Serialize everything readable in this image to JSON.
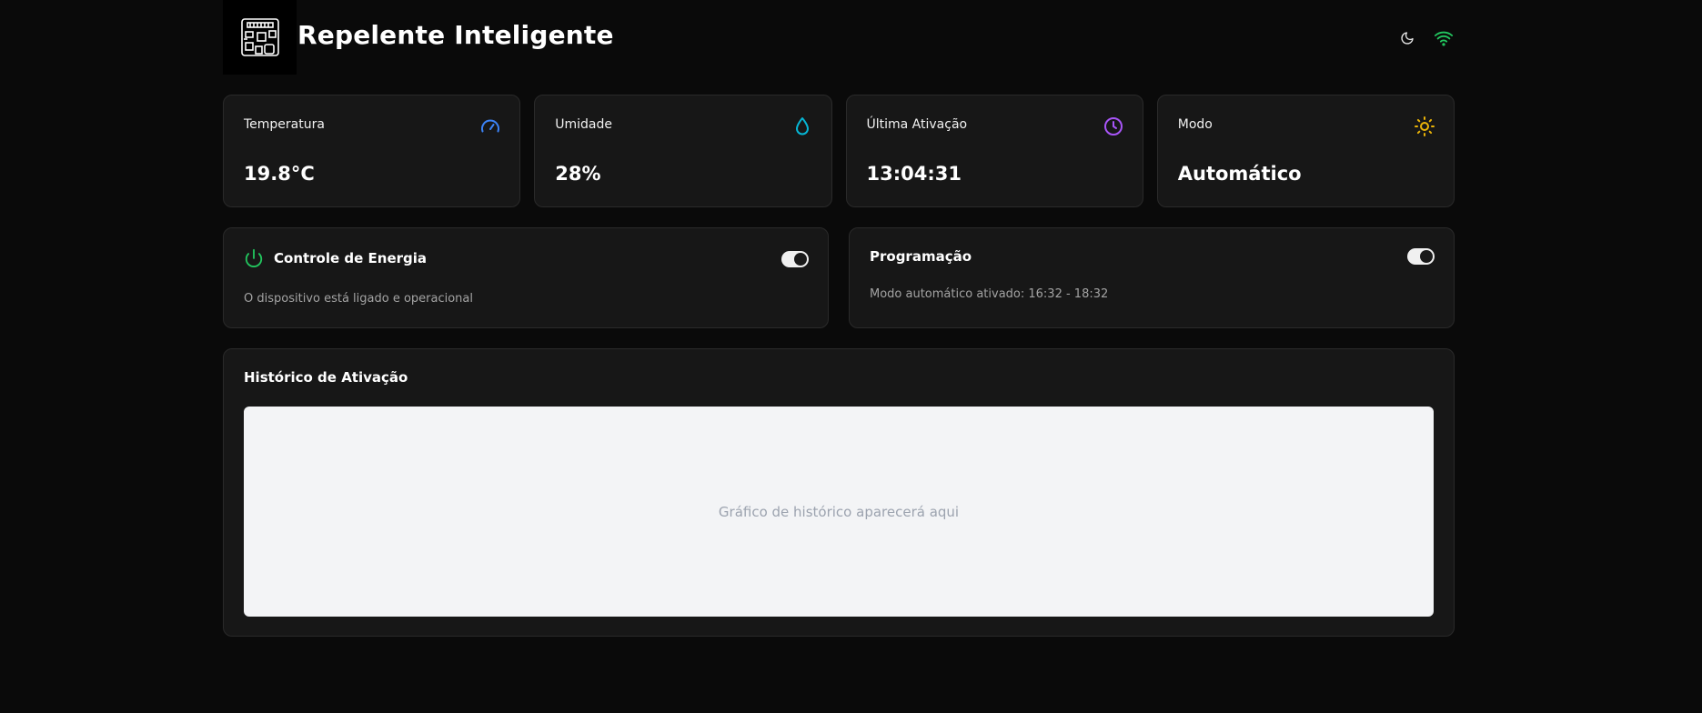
{
  "header": {
    "title": "Repelente Inteligente",
    "icons": [
      "circuit-board-icon",
      "moon-icon",
      "wifi-icon"
    ]
  },
  "stats": [
    {
      "label": "Temperatura",
      "value": "19.8°C",
      "icon": "gauge-icon",
      "color": "#3b82f6"
    },
    {
      "label": "Umidade",
      "value": "28%",
      "icon": "droplet-icon",
      "color": "#06b6d4"
    },
    {
      "label": "Última Ativação",
      "value": "13:04:31",
      "icon": "clock-icon",
      "color": "#a855f7"
    },
    {
      "label": "Modo",
      "value": "Automático",
      "icon": "sun-icon",
      "color": "#eab308"
    }
  ],
  "energy": {
    "title": "Controle de Energia",
    "description": "O dispositivo está ligado e operacional",
    "enabled": true,
    "icon": "power-icon",
    "color": "#22c55e"
  },
  "schedule": {
    "title": "Programação",
    "description": "Modo automático ativado: 16:32 - 18:32",
    "enabled": true
  },
  "history": {
    "title": "Histórico de Ativação",
    "placeholder": "Gráfico de histórico aparecerá aqui"
  },
  "colors": {
    "background": "#0a0a0a",
    "card": "#171717",
    "wifi": "#22c55e"
  }
}
